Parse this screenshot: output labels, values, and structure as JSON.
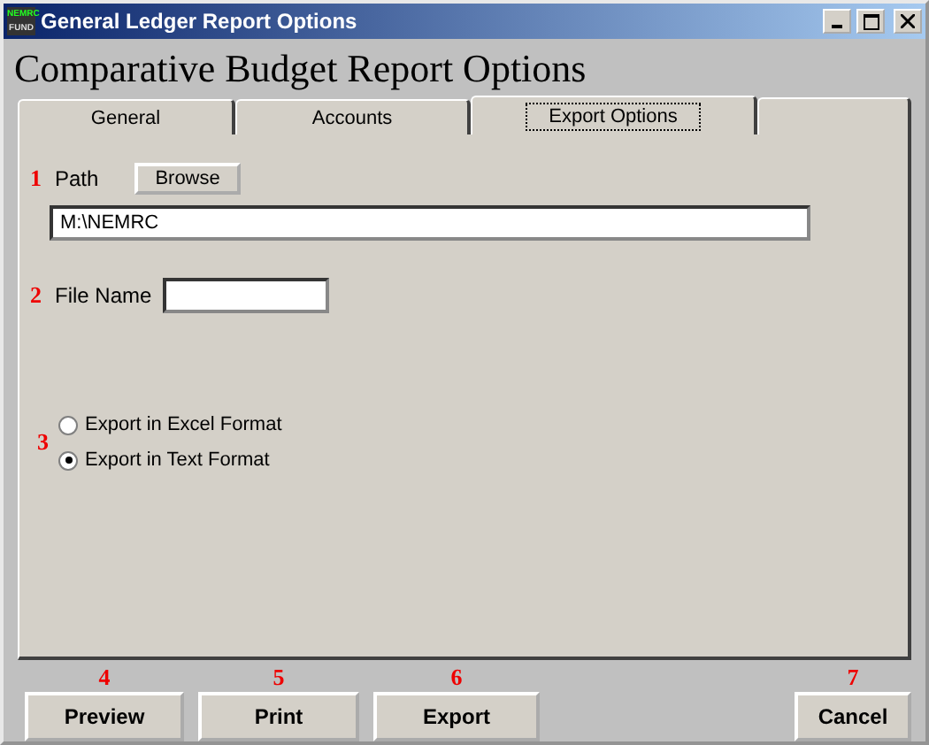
{
  "window": {
    "title": "General Ledger Report Options",
    "app_badge_top": "NEMRC",
    "app_badge_bottom": "FUND"
  },
  "heading": "Comparative Budget Report Options",
  "tabs": [
    {
      "label": "General",
      "selected": false
    },
    {
      "label": "Accounts",
      "selected": false
    },
    {
      "label": "Export Options",
      "selected": true
    }
  ],
  "path": {
    "marker": "1",
    "label": "Path",
    "browse_button": "Browse",
    "value": "M:\\NEMRC"
  },
  "file_name": {
    "marker": "2",
    "label": "File Name"
  },
  "format": {
    "marker": "3",
    "options": [
      {
        "label": "Export in Excel Format",
        "selected": false
      },
      {
        "label": "Export in Text Format",
        "selected": true
      }
    ]
  },
  "buttons": [
    {
      "marker": "4",
      "label": "Preview"
    },
    {
      "marker": "5",
      "label": "Print"
    },
    {
      "marker": "6",
      "label": "Export"
    },
    {
      "marker": "7",
      "label": "Cancel"
    }
  ]
}
